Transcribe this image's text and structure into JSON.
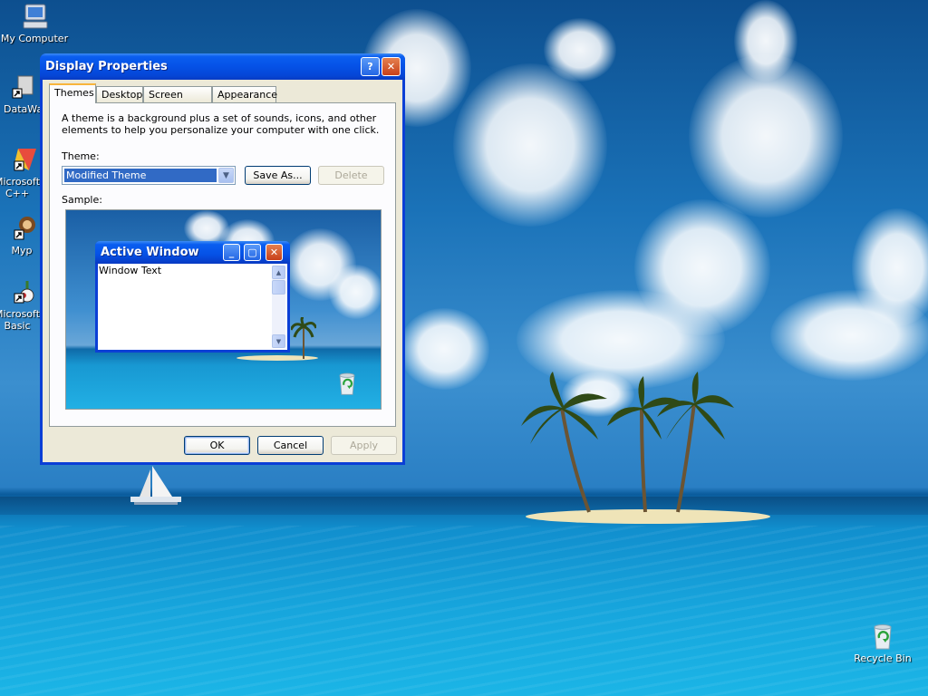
{
  "desktop": {
    "icons": [
      {
        "label": "My Computer",
        "icon": "my-computer-icon"
      },
      {
        "label": "DataWa",
        "icon": "shortcut-icon"
      },
      {
        "label": "Microsoft C++",
        "icon": "visual-cpp-icon"
      },
      {
        "label": "Myp",
        "icon": "shortcut-icon"
      },
      {
        "label": "Microsoft Basic",
        "icon": "visual-basic-icon"
      },
      {
        "label": "Recycle Bin",
        "icon": "recycle-bin-icon"
      }
    ]
  },
  "window": {
    "title": "Display Properties",
    "help_glyph": "?",
    "close_glyph": "✕",
    "tabs": [
      {
        "label": "Themes",
        "active": true
      },
      {
        "label": "Desktop",
        "active": false
      },
      {
        "label": "Screen Saver",
        "active": false
      },
      {
        "label": "Appearance",
        "active": false
      }
    ],
    "description": "A theme is a background plus a set of sounds, icons, and other elements to help you personalize your computer with one click.",
    "theme_label": "Theme:",
    "theme_value": "Modified Theme",
    "save_as_label": "Save As...",
    "delete_label": "Delete",
    "sample_label": "Sample:",
    "sample": {
      "window_title": "Active Window",
      "window_text": "Window Text"
    },
    "ok_label": "OK",
    "cancel_label": "Cancel",
    "apply_label": "Apply"
  },
  "colors": {
    "titlebar": "#0551e6",
    "dialog_face": "#ece9d8",
    "selection": "#316ac5",
    "active_tab_accent": "#f8b53c"
  }
}
